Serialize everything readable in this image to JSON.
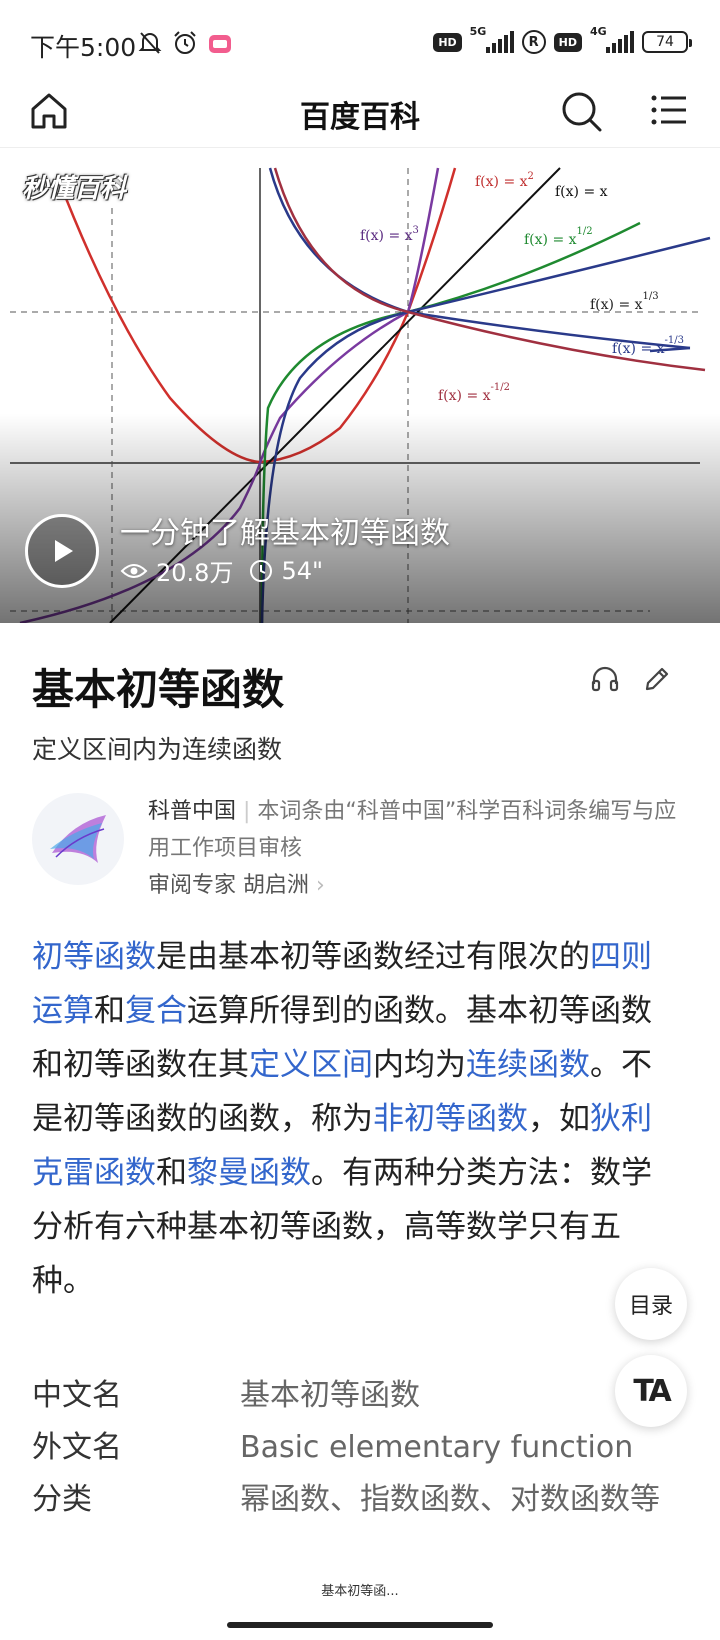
{
  "status": {
    "time": "下午5:00",
    "net1": "5G",
    "net2": "4G",
    "battery": "74",
    "hd": "HD",
    "r": "R"
  },
  "header": {
    "title": "百度百科",
    "icons": [
      "home-icon",
      "search-icon",
      "menu-icon"
    ]
  },
  "video": {
    "logo": "秒懂百科",
    "title": "一分钟了解基本初等函数",
    "views": "20.8万",
    "duration": "54\"",
    "formulas": {
      "x2": "f(x) = x",
      "x2e": "2",
      "x1": "f(x) = x",
      "x3": "f(x) = x",
      "x3e": "3",
      "xh": "f(x) = x",
      "xhe": "1/2",
      "xt": "f(x) = x",
      "xte": "1/3",
      "xmt": "f(x) = x",
      "xmte": "-1/3",
      "xmh": "f(x) = x",
      "xmhe": "-1/2"
    }
  },
  "article": {
    "title": "基本初等函数",
    "subtitle": "定义区间内为连续函数",
    "source": {
      "org": "科普中国",
      "desc": "本词条由“科普中国”科学百科词条编写与应用工作项目审核",
      "reviewer_label": "审阅专家",
      "reviewer": "胡启洲"
    },
    "body": [
      {
        "t": "初等函数",
        "link": true
      },
      {
        "t": "是由基本初等函数经过有限次的",
        "link": false
      },
      {
        "t": "四则运算",
        "link": true
      },
      {
        "t": "和",
        "link": false
      },
      {
        "t": "复合",
        "link": true
      },
      {
        "t": "运算所得到的函数。基本初等函数和初等函数在其",
        "link": false
      },
      {
        "t": "定义区间",
        "link": true
      },
      {
        "t": "内均为",
        "link": false
      },
      {
        "t": "连续函数",
        "link": true
      },
      {
        "t": "。不是初等函数的函数，称为",
        "link": false
      },
      {
        "t": "非初等函数",
        "link": true
      },
      {
        "t": "，如",
        "link": false
      },
      {
        "t": "狄利克雷函数",
        "link": true
      },
      {
        "t": "和",
        "link": false
      },
      {
        "t": "黎曼函数",
        "link": true
      },
      {
        "t": "。有两种分类方法：数学分析有六种基本初等函数，高等数学只有五种。",
        "link": false
      }
    ],
    "info": [
      {
        "k": "中文名",
        "v": "基本初等函数"
      },
      {
        "k": "外文名",
        "v": "Basic elementary function"
      },
      {
        "k": "分类",
        "v": "幂函数、指数函数、对数函数等"
      }
    ]
  },
  "fab": {
    "toc": "目录",
    "font": "TA"
  },
  "bottom_label": "基本初等函..."
}
